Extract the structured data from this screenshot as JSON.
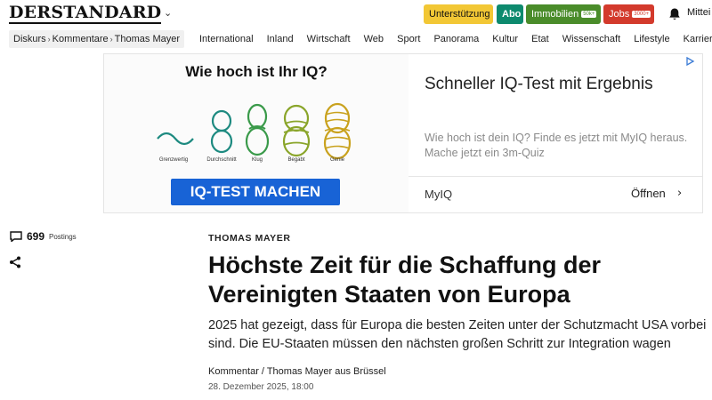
{
  "header": {
    "logo": "DERSTANDARD",
    "buttons": {
      "support": "Unterstützung",
      "abo": "Abo",
      "immobilien": "Immobilien",
      "immobilien_badge": "50k+",
      "jobs": "Jobs",
      "jobs_badge": "3000+"
    },
    "user_label": "Mittei"
  },
  "breadcrumb": {
    "items": [
      "Diskurs",
      "Kommentare",
      "Thomas Mayer"
    ]
  },
  "nav": {
    "items": [
      "International",
      "Inland",
      "Wirtschaft",
      "Web",
      "Sport",
      "Panorama",
      "Kultur",
      "Etat",
      "Wissenschaft",
      "Lifestyle",
      "Karriere"
    ]
  },
  "ad": {
    "image_heading": "Wie hoch ist Ihr IQ?",
    "figure_labels": [
      "Grenzwertig",
      "Durchschnitt",
      "Klug",
      "Begabt",
      "Genie"
    ],
    "cta": "IQ-TEST MACHEN",
    "title": "Schneller IQ-Test mit Ergebnis",
    "description": "Wie hoch ist dein IQ? Finde es jetzt mit MyIQ heraus. Mache jetzt ein 3m-Quiz",
    "brand": "MyIQ",
    "open_label": "Öffnen"
  },
  "article": {
    "postings_count": "699",
    "postings_label": "Postings",
    "kicker": "THOMAS MAYER",
    "headline": "Höchste Zeit für die Schaffung der Vereinigten Staaten von Europa",
    "lead": "2025 hat gezeigt, dass für Europa die besten Zeiten unter der Schutzmacht USA vorbei sind. Die EU-Staaten müssen den nächsten großen Schritt zur Integration wagen",
    "byline": "Kommentar / Thomas Mayer aus Brüssel",
    "date": "28. Dezember 2025, 18:00"
  },
  "colors": {
    "support": "#f2c735",
    "abo": "#0d8a6e",
    "immobilien": "#4a8c2a",
    "jobs": "#d33a2c",
    "ad_cta": "#1863d6"
  },
  "icons": [
    "chevron-down-icon",
    "bell-icon",
    "adchoices-icon",
    "chevron-right-icon",
    "comment-icon",
    "share-icon"
  ]
}
